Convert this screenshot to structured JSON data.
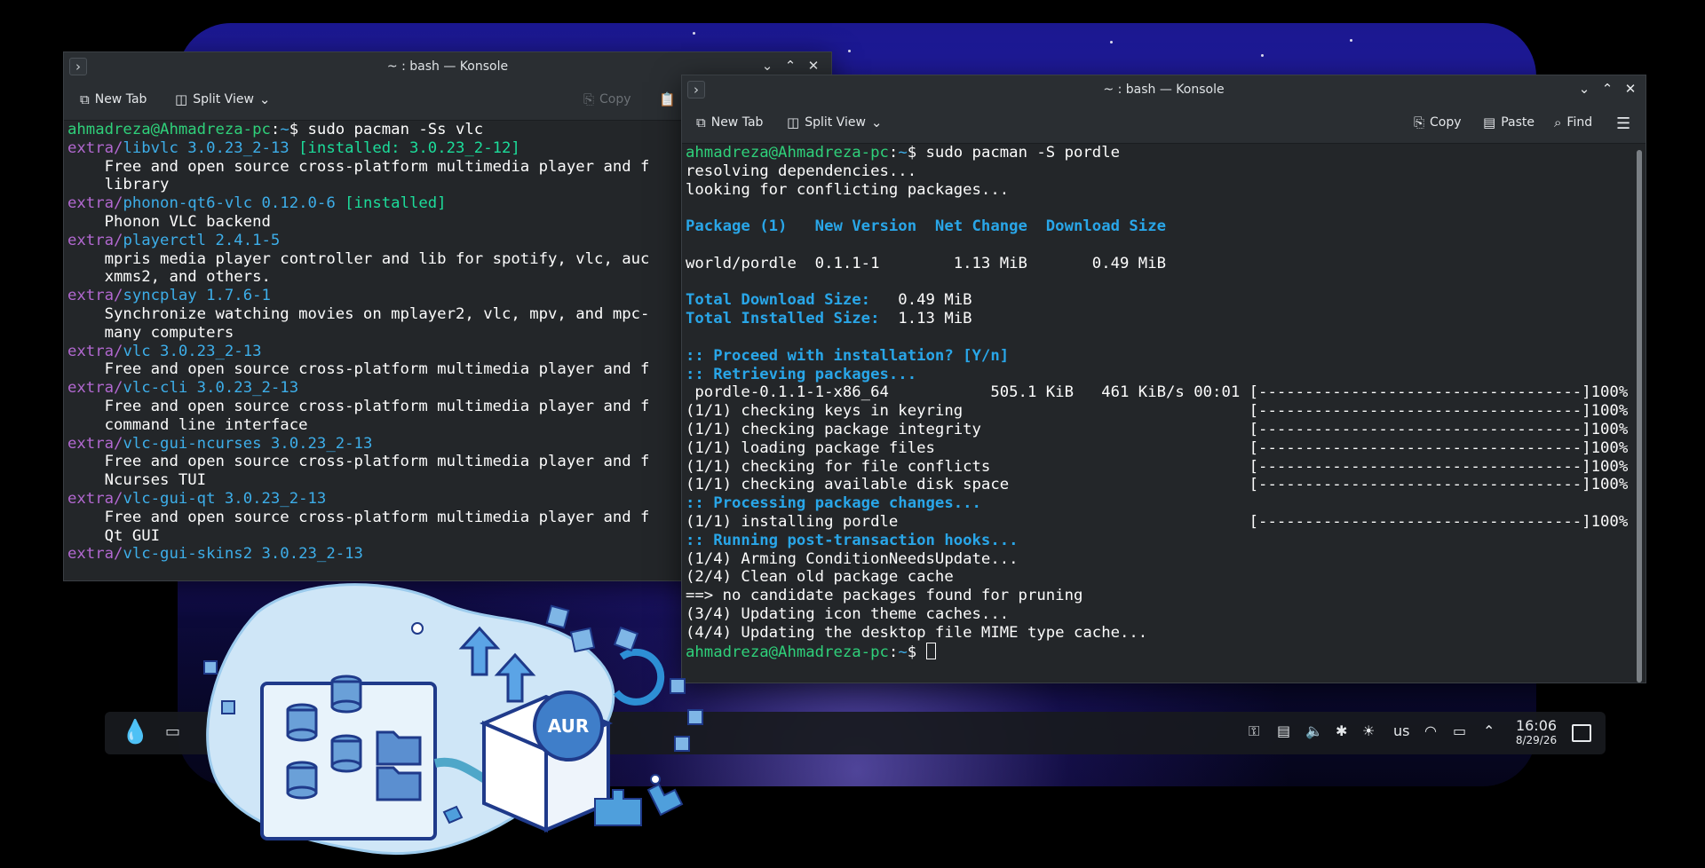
{
  "win1": {
    "title": "~ : bash — Konsole",
    "toolbar": {
      "new_tab": "New Tab",
      "split_view": "Split View",
      "copy": "Copy"
    },
    "lines": [
      [
        [
          "g",
          "ahmadreza@Ahmadreza-pc"
        ],
        [
          "w",
          ":"
        ],
        [
          "b",
          "~"
        ],
        [
          "w",
          "$ sudo pacman -Ss vlc"
        ]
      ],
      [
        [
          "p",
          "extra/"
        ],
        [
          "b",
          "libvlc 3.0.23_2-13 "
        ],
        [
          "c",
          "[installed: 3.0.23_2-12]"
        ]
      ],
      [
        [
          "w",
          "    Free and open source cross-platform multimedia player and f"
        ]
      ],
      [
        [
          "w",
          "    library"
        ]
      ],
      [
        [
          "p",
          "extra/"
        ],
        [
          "b",
          "phonon-qt6-vlc 0.12.0-6 "
        ],
        [
          "c",
          "[installed]"
        ]
      ],
      [
        [
          "w",
          "    Phonon VLC backend"
        ]
      ],
      [
        [
          "p",
          "extra/"
        ],
        [
          "b",
          "playerctl 2.4.1-5"
        ]
      ],
      [
        [
          "w",
          "    mpris media player controller and lib for spotify, vlc, auc"
        ]
      ],
      [
        [
          "w",
          "    xmms2, and others."
        ]
      ],
      [
        [
          "p",
          "extra/"
        ],
        [
          "b",
          "syncplay 1.7.6-1"
        ]
      ],
      [
        [
          "w",
          "    Synchronize watching movies on mplayer2, vlc, mpv, and mpc-"
        ]
      ],
      [
        [
          "w",
          "    many computers"
        ]
      ],
      [
        [
          "p",
          "extra/"
        ],
        [
          "b",
          "vlc 3.0.23_2-13"
        ]
      ],
      [
        [
          "w",
          "    Free and open source cross-platform multimedia player and f"
        ]
      ],
      [
        [
          "p",
          "extra/"
        ],
        [
          "b",
          "vlc-cli 3.0.23_2-13"
        ]
      ],
      [
        [
          "w",
          "    Free and open source cross-platform multimedia player and f"
        ]
      ],
      [
        [
          "w",
          "    command line interface"
        ]
      ],
      [
        [
          "p",
          "extra/"
        ],
        [
          "b",
          "vlc-gui-ncurses 3.0.23_2-13"
        ]
      ],
      [
        [
          "w",
          "    Free and open source cross-platform multimedia player and f"
        ]
      ],
      [
        [
          "w",
          "    Ncurses TUI"
        ]
      ],
      [
        [
          "p",
          "extra/"
        ],
        [
          "b",
          "vlc-gui-qt 3.0.23_2-13"
        ]
      ],
      [
        [
          "w",
          "    Free and open source cross-platform multimedia player and f"
        ]
      ],
      [
        [
          "w",
          "    Qt GUI"
        ]
      ],
      [
        [
          "p",
          "extra/"
        ],
        [
          "b",
          "vlc-gui-skins2 3.0.23_2-13"
        ]
      ]
    ]
  },
  "win2": {
    "title": "~ : bash — Konsole",
    "toolbar": {
      "new_tab": "New Tab",
      "split_view": "Split View",
      "copy": "Copy",
      "paste": "Paste",
      "find": "Find"
    },
    "lines": [
      [
        [
          "g",
          "ahmadreza@Ahmadreza-pc"
        ],
        [
          "w",
          ":"
        ],
        [
          "b",
          "~"
        ],
        [
          "w",
          "$ sudo pacman -S pordle"
        ]
      ],
      [
        [
          "w",
          "resolving dependencies..."
        ]
      ],
      [
        [
          "w",
          "looking for conflicting packages..."
        ]
      ],
      [
        [
          "w",
          ""
        ]
      ],
      [
        [
          "bb",
          "Package (1)   New Version  Net Change  Download Size"
        ]
      ],
      [
        [
          "w",
          ""
        ]
      ],
      [
        [
          "w",
          "world/pordle  0.1.1-1        1.13 MiB       0.49 MiB"
        ]
      ],
      [
        [
          "w",
          ""
        ]
      ],
      [
        [
          "bb",
          "Total Download Size:"
        ],
        [
          "w",
          "   0.49 MiB"
        ]
      ],
      [
        [
          "bb",
          "Total Installed Size:"
        ],
        [
          "w",
          "  1.13 MiB"
        ]
      ],
      [
        [
          "w",
          ""
        ]
      ],
      [
        [
          "bb",
          ":: Proceed with installation? [Y/n]"
        ]
      ],
      [
        [
          "bb",
          ":: Retrieving packages..."
        ]
      ],
      [
        [
          "w",
          " pordle-0.1.1-1-x86_64           505.1 KiB   461 KiB/s 00:01 [-----------------------------------]100%"
        ]
      ],
      [
        [
          "w",
          "(1/1) checking keys in keyring                               [-----------------------------------]100%"
        ]
      ],
      [
        [
          "w",
          "(1/1) checking package integrity                             [-----------------------------------]100%"
        ]
      ],
      [
        [
          "w",
          "(1/1) loading package files                                  [-----------------------------------]100%"
        ]
      ],
      [
        [
          "w",
          "(1/1) checking for file conflicts                            [-----------------------------------]100%"
        ]
      ],
      [
        [
          "w",
          "(1/1) checking available disk space                          [-----------------------------------]100%"
        ]
      ],
      [
        [
          "bb",
          ":: Processing package changes..."
        ]
      ],
      [
        [
          "w",
          "(1/1) installing pordle                                      [-----------------------------------]100%"
        ]
      ],
      [
        [
          "bb",
          ":: Running post-transaction hooks..."
        ]
      ],
      [
        [
          "w",
          "(1/4) Arming ConditionNeedsUpdate..."
        ]
      ],
      [
        [
          "w",
          "(2/4) Clean old package cache"
        ]
      ],
      [
        [
          "w",
          "==> no candidate packages found for pruning"
        ]
      ],
      [
        [
          "w",
          "(3/4) Updating icon theme caches..."
        ]
      ],
      [
        [
          "w",
          "(4/4) Updating the desktop file MIME type cache..."
        ]
      ],
      [
        [
          "g",
          "ahmadreza@Ahmadreza-pc"
        ],
        [
          "w",
          ":"
        ],
        [
          "b",
          "~"
        ],
        [
          "w",
          "$ "
        ]
      ]
    ]
  },
  "illustration": {
    "badge": "AUR"
  },
  "taskbar": {
    "keyboard_layout": "us",
    "time": "16:06",
    "date": "8/29/26"
  },
  "icons": {
    "menu": "chevron-right-icon",
    "minimize": "chevron-down-icon",
    "maximize": "chevron-up-icon",
    "close": "close-icon",
    "new_tab": "new-tab-icon",
    "split": "split-view-icon",
    "copy": "copy-icon",
    "paste": "paste-icon",
    "find": "search-icon",
    "hamburger": "hamburger-menu-icon"
  },
  "colors": {
    "prompt_user": "#2fd07a",
    "path": "#3daee9",
    "repo": "#b268d0",
    "installed_tag": "#1cdc9a",
    "terminal_bg": "#232629",
    "chrome_bg": "#2a2e32"
  }
}
